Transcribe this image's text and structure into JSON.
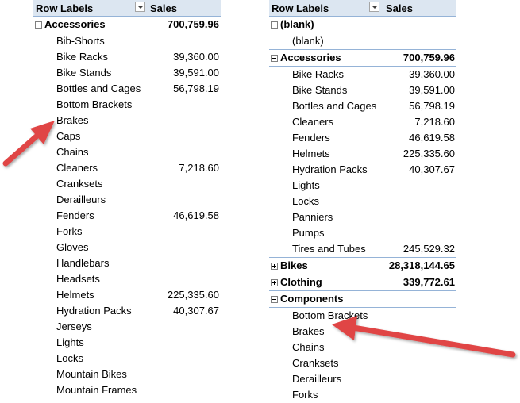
{
  "left_pivot": {
    "header": {
      "row_labels": "Row Labels",
      "sales": "Sales"
    },
    "group": {
      "label": "Accessories",
      "value": "700,759.96",
      "expanded": true
    },
    "rows": [
      {
        "label": "Bib-Shorts",
        "value": ""
      },
      {
        "label": "Bike Racks",
        "value": "39,360.00"
      },
      {
        "label": "Bike Stands",
        "value": "39,591.00"
      },
      {
        "label": "Bottles and Cages",
        "value": "56,798.19"
      },
      {
        "label": "Bottom Brackets",
        "value": ""
      },
      {
        "label": "Brakes",
        "value": ""
      },
      {
        "label": "Caps",
        "value": ""
      },
      {
        "label": "Chains",
        "value": ""
      },
      {
        "label": "Cleaners",
        "value": "7,218.60"
      },
      {
        "label": "Cranksets",
        "value": ""
      },
      {
        "label": "Derailleurs",
        "value": ""
      },
      {
        "label": "Fenders",
        "value": "46,619.58"
      },
      {
        "label": "Forks",
        "value": ""
      },
      {
        "label": "Gloves",
        "value": ""
      },
      {
        "label": "Handlebars",
        "value": ""
      },
      {
        "label": "Headsets",
        "value": ""
      },
      {
        "label": "Helmets",
        "value": "225,335.60"
      },
      {
        "label": "Hydration Packs",
        "value": "40,307.67"
      },
      {
        "label": "Jerseys",
        "value": ""
      },
      {
        "label": "Lights",
        "value": ""
      },
      {
        "label": "Locks",
        "value": ""
      },
      {
        "label": "Mountain Bikes",
        "value": ""
      },
      {
        "label": "Mountain Frames",
        "value": ""
      }
    ]
  },
  "right_pivot": {
    "header": {
      "row_labels": "Row Labels",
      "sales": "Sales"
    },
    "blank_group": {
      "label": "(blank)",
      "child": "(blank)",
      "expanded": true
    },
    "accessories_group": {
      "label": "Accessories",
      "value": "700,759.96",
      "expanded": true
    },
    "accessories_rows": [
      {
        "label": "Bike Racks",
        "value": "39,360.00"
      },
      {
        "label": "Bike Stands",
        "value": "39,591.00"
      },
      {
        "label": "Bottles and Cages",
        "value": "56,798.19"
      },
      {
        "label": "Cleaners",
        "value": "7,218.60"
      },
      {
        "label": "Fenders",
        "value": "46,619.58"
      },
      {
        "label": "Helmets",
        "value": "225,335.60"
      },
      {
        "label": "Hydration Packs",
        "value": "40,307.67"
      },
      {
        "label": "Lights",
        "value": ""
      },
      {
        "label": "Locks",
        "value": ""
      },
      {
        "label": "Panniers",
        "value": ""
      },
      {
        "label": "Pumps",
        "value": ""
      },
      {
        "label": "Tires and Tubes",
        "value": "245,529.32"
      }
    ],
    "bikes_group": {
      "label": "Bikes",
      "value": "28,318,144.65",
      "expanded": false
    },
    "clothing_group": {
      "label": "Clothing",
      "value": "339,772.61",
      "expanded": false
    },
    "components_group": {
      "label": "Components",
      "value": "",
      "expanded": true
    },
    "components_rows": [
      {
        "label": "Bottom Brackets",
        "value": ""
      },
      {
        "label": "Brakes",
        "value": ""
      },
      {
        "label": "Chains",
        "value": ""
      },
      {
        "label": "Cranksets",
        "value": ""
      },
      {
        "label": "Derailleurs",
        "value": ""
      },
      {
        "label": "Forks",
        "value": ""
      }
    ]
  },
  "annotations": {
    "arrow_color": "#e04545",
    "header_fill": "#dce6f1",
    "border_color": "#95b3d7"
  }
}
